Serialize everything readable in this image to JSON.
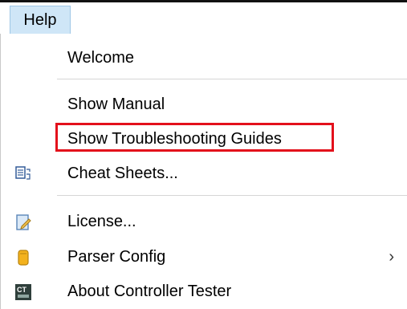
{
  "menubar": {
    "help_label": "Help"
  },
  "menu": {
    "items": [
      {
        "label": "Welcome",
        "icon": null
      },
      {
        "label": "Show Manual",
        "icon": null
      },
      {
        "label": "Show Troubleshooting Guides",
        "icon": null
      },
      {
        "label": "Cheat Sheets...",
        "icon": "cheat-sheets-icon"
      },
      {
        "label": "License...",
        "icon": "license-icon"
      },
      {
        "label": "Parser Config",
        "icon": "parser-config-icon",
        "submenu_arrow": "›"
      },
      {
        "label": "About Controller Tester",
        "icon": "about-icon"
      }
    ]
  },
  "colors": {
    "menu_tab_bg": "#cfe6f7",
    "highlight": "#e3101b",
    "separator": "#d6d6d6"
  }
}
